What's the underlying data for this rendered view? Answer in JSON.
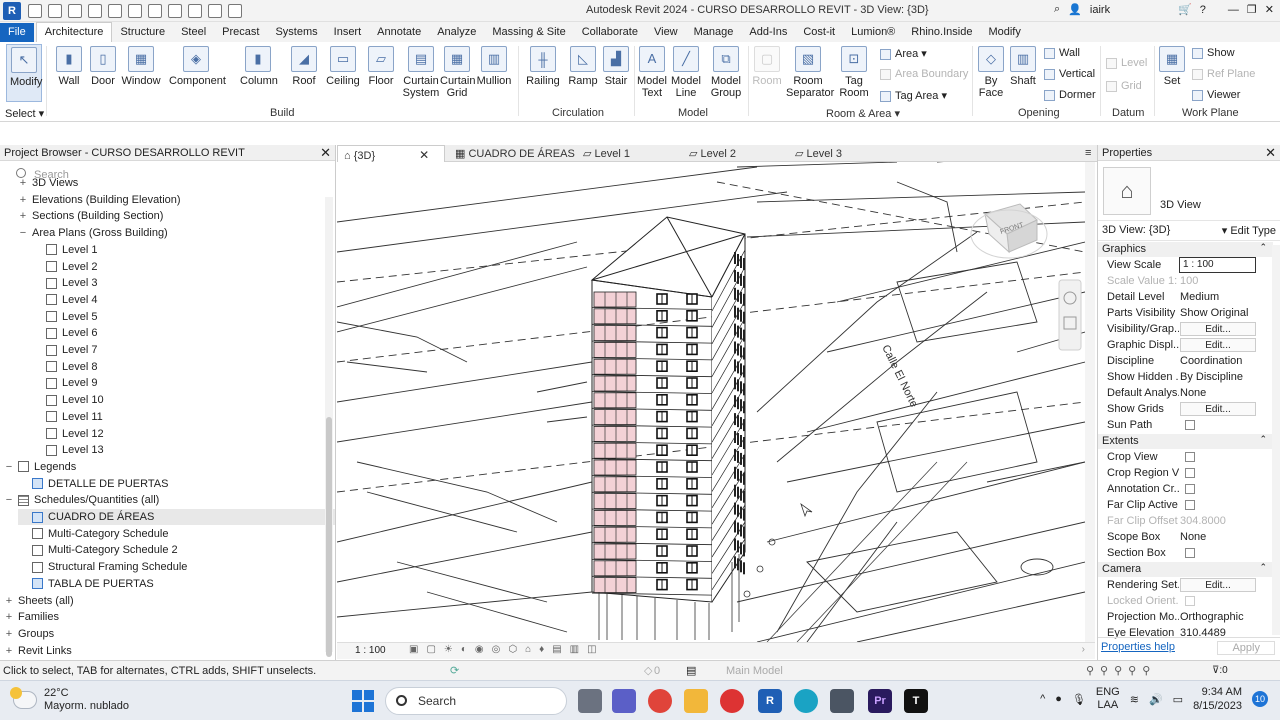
{
  "app": {
    "title": "Autodesk Revit 2024 - CURSO DESARROLLO REVIT - 3D View: {3D}",
    "logo": "R",
    "user": "iairk"
  },
  "ribbon_tabs": [
    "File",
    "Architecture",
    "Structure",
    "Steel",
    "Precast",
    "Systems",
    "Insert",
    "Annotate",
    "Analyze",
    "Massing & Site",
    "Collaborate",
    "View",
    "Manage",
    "Add-Ins",
    "Cost-it",
    "Lumion®",
    "Rhino.Inside",
    "Modify"
  ],
  "ribbon": {
    "modify": "Modify",
    "select": "Select",
    "wall": "Wall",
    "door": "Door",
    "window": "Window",
    "component": "Component",
    "column": "Column",
    "roof": "Roof",
    "ceiling": "Ceiling",
    "floor": "Floor",
    "curtain_system": "Curtain System",
    "curtain_grid": "Curtain Grid",
    "mullion": "Mullion",
    "railing": "Railing",
    "ramp": "Ramp",
    "stair": "Stair",
    "model_text": "Model Text",
    "model_line": "Model Line",
    "model_group": "Model Group",
    "room": "Room",
    "room_separator": "Room Separator",
    "tag_room": "Tag Room",
    "area": "Area",
    "area_boundary": "Area Boundary",
    "tag_area": "Tag Area",
    "by_face": "By Face",
    "shaft": "Shaft",
    "wall_op": "Wall",
    "vertical": "Vertical",
    "dormer": "Dormer",
    "level": "Level",
    "grid": "Grid",
    "set": "Set",
    "show": "Show",
    "ref_plane": "Ref Plane",
    "viewer": "Viewer",
    "groups": {
      "build": "Build",
      "circulation": "Circulation",
      "model": "Model",
      "room_area": "Room & Area",
      "opening": "Opening",
      "datum": "Datum",
      "work_plane": "Work Plane"
    }
  },
  "project_browser": {
    "title": "Project Browser - CURSO DESARROLLO REVIT",
    "search_placeholder": "Search",
    "items": [
      {
        "label": "3D Views",
        "level": 1,
        "ex": "+",
        "icon": "none"
      },
      {
        "label": "Elevations (Building Elevation)",
        "level": 1,
        "ex": "+",
        "icon": "none"
      },
      {
        "label": "Sections (Building Section)",
        "level": 1,
        "ex": "+",
        "icon": "none"
      },
      {
        "label": "Area Plans (Gross Building)",
        "level": 1,
        "ex": "−",
        "icon": "none"
      },
      {
        "label": "Level 1",
        "level": 2,
        "ex": "",
        "icon": "view"
      },
      {
        "label": "Level 2",
        "level": 2,
        "ex": "",
        "icon": "view"
      },
      {
        "label": "Level 3",
        "level": 2,
        "ex": "",
        "icon": "view"
      },
      {
        "label": "Level 4",
        "level": 2,
        "ex": "",
        "icon": "view"
      },
      {
        "label": "Level 5",
        "level": 2,
        "ex": "",
        "icon": "view"
      },
      {
        "label": "Level 6",
        "level": 2,
        "ex": "",
        "icon": "view"
      },
      {
        "label": "Level 7",
        "level": 2,
        "ex": "",
        "icon": "view"
      },
      {
        "label": "Level 8",
        "level": 2,
        "ex": "",
        "icon": "view"
      },
      {
        "label": "Level 9",
        "level": 2,
        "ex": "",
        "icon": "view"
      },
      {
        "label": "Level 10",
        "level": 2,
        "ex": "",
        "icon": "view"
      },
      {
        "label": "Level 11",
        "level": 2,
        "ex": "",
        "icon": "view"
      },
      {
        "label": "Level 12",
        "level": 2,
        "ex": "",
        "icon": "view"
      },
      {
        "label": "Level 13",
        "level": 2,
        "ex": "",
        "icon": "view"
      },
      {
        "label": "Legends",
        "level": 0,
        "ex": "−",
        "icon": "view"
      },
      {
        "label": "DETALLE DE PUERTAS",
        "level": 1,
        "ex": "",
        "icon": "blue"
      },
      {
        "label": "Schedules/Quantities (all)",
        "level": 0,
        "ex": "−",
        "icon": "grid"
      },
      {
        "label": "CUADRO DE ÁREAS",
        "level": 1,
        "ex": "",
        "icon": "blue",
        "selected": true
      },
      {
        "label": "Multi-Category Schedule",
        "level": 1,
        "ex": "",
        "icon": "view"
      },
      {
        "label": "Multi-Category Schedule 2",
        "level": 1,
        "ex": "",
        "icon": "view"
      },
      {
        "label": "Structural Framing Schedule",
        "level": 1,
        "ex": "",
        "icon": "view"
      },
      {
        "label": "TABLA DE PUERTAS",
        "level": 1,
        "ex": "",
        "icon": "blue"
      },
      {
        "label": "Sheets (all)",
        "level": 0,
        "ex": "+",
        "icon": "none"
      },
      {
        "label": "Families",
        "level": 0,
        "ex": "+",
        "icon": "none"
      },
      {
        "label": "Groups",
        "level": 0,
        "ex": "+",
        "icon": "none"
      },
      {
        "label": "Revit Links",
        "level": 0,
        "ex": "+",
        "icon": "none"
      }
    ]
  },
  "view_tabs": [
    "{3D}",
    "CUADRO DE ÁREAS",
    "Level 1",
    "Level 2",
    "Level 3"
  ],
  "view_cube_label": "FRONT",
  "street_label": "Calle El Norte",
  "view_scale_bar": "1 : 100",
  "properties": {
    "title": "Properties",
    "type_name": "3D View",
    "selector": "3D View: {3D}",
    "edit_type": "Edit Type",
    "sections": {
      "graphics": "Graphics",
      "extents": "Extents",
      "camera": "Camera"
    },
    "rows": {
      "view_scale": {
        "k": "View Scale",
        "v": "1 : 100"
      },
      "scale_value": {
        "k": "Scale Value    1:",
        "v": "100"
      },
      "detail_level": {
        "k": "Detail Level",
        "v": "Medium"
      },
      "parts_visibility": {
        "k": "Parts Visibility",
        "v": "Show Original"
      },
      "vg": {
        "k": "Visibility/Grap...",
        "v": "Edit..."
      },
      "gd": {
        "k": "Graphic Displ...",
        "v": "Edit..."
      },
      "discipline": {
        "k": "Discipline",
        "v": "Coordination"
      },
      "show_hidden": {
        "k": "Show Hidden ...",
        "v": "By Discipline"
      },
      "default_analysis": {
        "k": "Default Analys...",
        "v": "None"
      },
      "show_grids": {
        "k": "Show Grids",
        "v": "Edit..."
      },
      "sun_path": {
        "k": "Sun Path"
      },
      "crop_view": {
        "k": "Crop View"
      },
      "crop_region": {
        "k": "Crop Region V..."
      },
      "annotation_crop": {
        "k": "Annotation Cr..."
      },
      "far_clip_active": {
        "k": "Far Clip Active"
      },
      "far_clip_offset": {
        "k": "Far Clip Offset",
        "v": "304.8000"
      },
      "scope_box": {
        "k": "Scope Box",
        "v": "None"
      },
      "section_box": {
        "k": "Section Box"
      },
      "rendering": {
        "k": "Rendering Set...",
        "v": "Edit..."
      },
      "locked_orient": {
        "k": "Locked Orient..."
      },
      "projection": {
        "k": "Projection Mo...",
        "v": "Orthographic"
      },
      "eye_elevation": {
        "k": "Eye Elevation",
        "v": "310.4489"
      }
    },
    "help": "Properties help",
    "apply": "Apply"
  },
  "status_bar": {
    "message": "Click to select, TAB for alternates, CTRL adds, SHIFT unselects.",
    "model": "Main Model",
    "count": "0",
    "filter": ":0"
  },
  "taskbar": {
    "temp": "22°C",
    "weather": "Mayorm. nublado",
    "search": "Search",
    "lang1": "ENG",
    "lang2": "LAA",
    "time": "9:34 AM",
    "date": "8/15/2023",
    "notifications": "10"
  },
  "colors": {
    "accent": "#1565c0",
    "curtain_panel": "#f3d1d6",
    "selection": "#e8e8e8"
  }
}
